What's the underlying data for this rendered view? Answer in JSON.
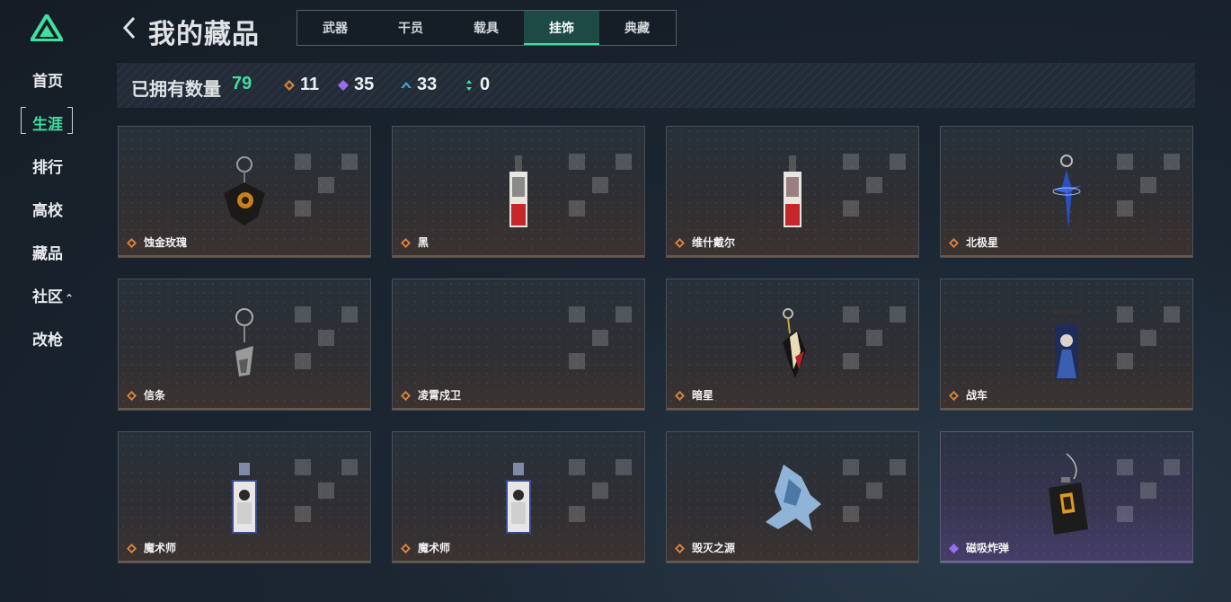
{
  "sidebar": {
    "items": [
      {
        "label": "首页",
        "active": false
      },
      {
        "label": "生涯",
        "active": true
      },
      {
        "label": "排行",
        "active": false
      },
      {
        "label": "高校",
        "active": false
      },
      {
        "label": "藏品",
        "active": false
      },
      {
        "label": "社区",
        "active": false,
        "has_chevron": true
      },
      {
        "label": "改枪",
        "active": false
      }
    ]
  },
  "header": {
    "title": "我的藏品",
    "tabs": [
      {
        "label": "武器",
        "active": false
      },
      {
        "label": "干员",
        "active": false
      },
      {
        "label": "载具",
        "active": false
      },
      {
        "label": "挂饰",
        "active": true
      },
      {
        "label": "典藏",
        "active": false
      }
    ]
  },
  "stats": {
    "label": "已拥有数量",
    "total": "79",
    "counts": [
      {
        "icon": "orange-diamond-icon",
        "value": "11",
        "color": "#d9823b"
      },
      {
        "icon": "purple-diamond-icon",
        "value": "35",
        "color": "#9a6cf0"
      },
      {
        "icon": "blue-chevron-icon",
        "value": "33",
        "color": "#4aa3e0"
      },
      {
        "icon": "green-arrows-icon",
        "value": "0",
        "color": "#3fe0a0"
      }
    ]
  },
  "items": [
    {
      "name": "蚀金玫瑰",
      "rarity": "orange"
    },
    {
      "name": "黑",
      "rarity": "orange"
    },
    {
      "name": "维什戴尔",
      "rarity": "orange"
    },
    {
      "name": "北极星",
      "rarity": "orange"
    },
    {
      "name": "信条",
      "rarity": "orange"
    },
    {
      "name": "凌霄戍卫",
      "rarity": "orange"
    },
    {
      "name": "暗星",
      "rarity": "orange"
    },
    {
      "name": "战车",
      "rarity": "orange"
    },
    {
      "name": "魔术师",
      "rarity": "orange"
    },
    {
      "name": "魔术师",
      "rarity": "orange"
    },
    {
      "name": "毁灭之源",
      "rarity": "orange"
    },
    {
      "name": "磁吸炸弹",
      "rarity": "purple"
    }
  ],
  "colors": {
    "accent": "#3fe0a0",
    "orange_rarity": "#d9823b",
    "purple_rarity": "#9a6cf0"
  }
}
